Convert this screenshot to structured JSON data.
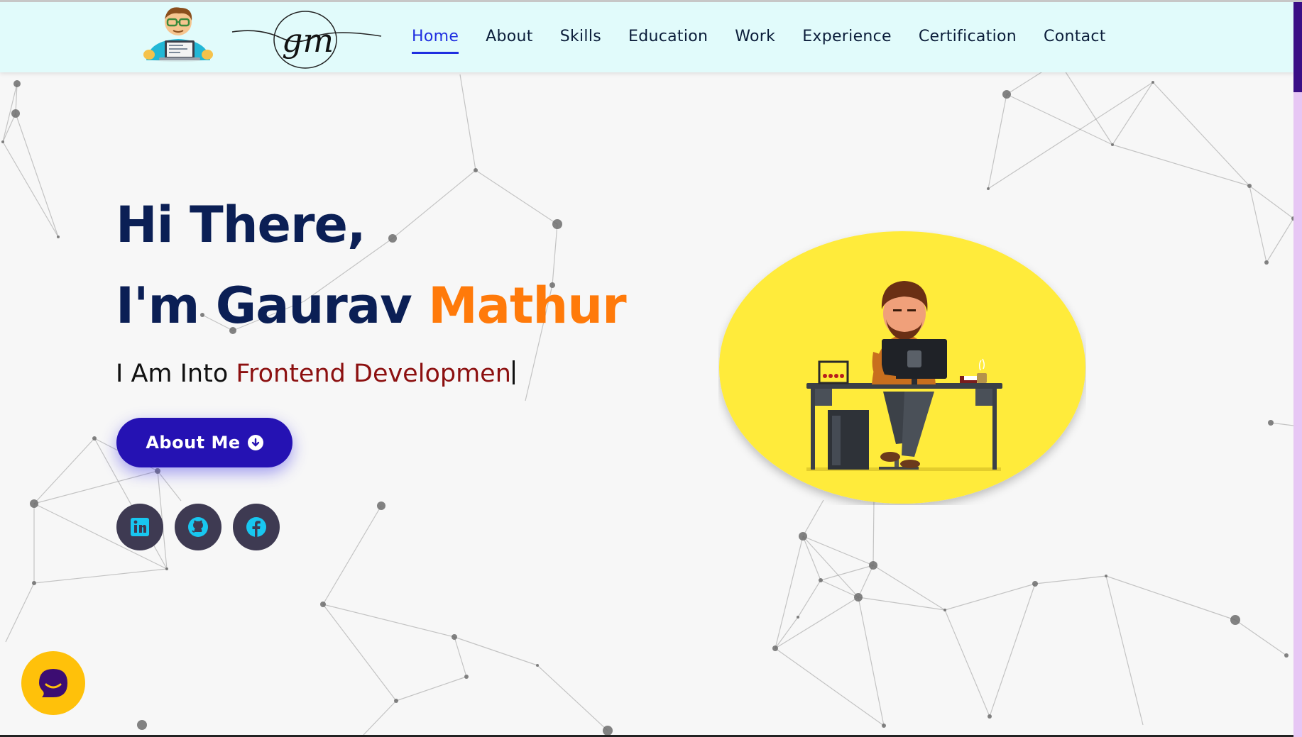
{
  "nav": {
    "items": [
      {
        "label": "Home",
        "active": true
      },
      {
        "label": "About",
        "active": false
      },
      {
        "label": "Skills",
        "active": false
      },
      {
        "label": "Education",
        "active": false
      },
      {
        "label": "Work",
        "active": false
      },
      {
        "label": "Experience",
        "active": false
      },
      {
        "label": "Certification",
        "active": false
      },
      {
        "label": "Contact",
        "active": false
      }
    ],
    "logo_text": "gm"
  },
  "hero": {
    "greeting": "Hi There,",
    "name_prefix": "I'm Gaurav",
    "name_accent": "Mathur",
    "sub_prefix": "I Am Into",
    "sub_typed": "Frontend Developmen",
    "about_button": "About Me"
  },
  "social": [
    {
      "name": "linkedin-icon"
    },
    {
      "name": "github-icon"
    },
    {
      "name": "facebook-icon"
    }
  ],
  "colors": {
    "header_bg": "#e1fbfb",
    "nav_active": "#1f2ee0",
    "title": "#0b1f55",
    "accent": "#ff7a0a",
    "typed": "#8c1010",
    "button": "#2512b3",
    "social_bg": "#3e3a52",
    "social_icon": "#18c7f0",
    "chat": "#ffc10a",
    "illustration_bg": "#ffeb3b"
  }
}
